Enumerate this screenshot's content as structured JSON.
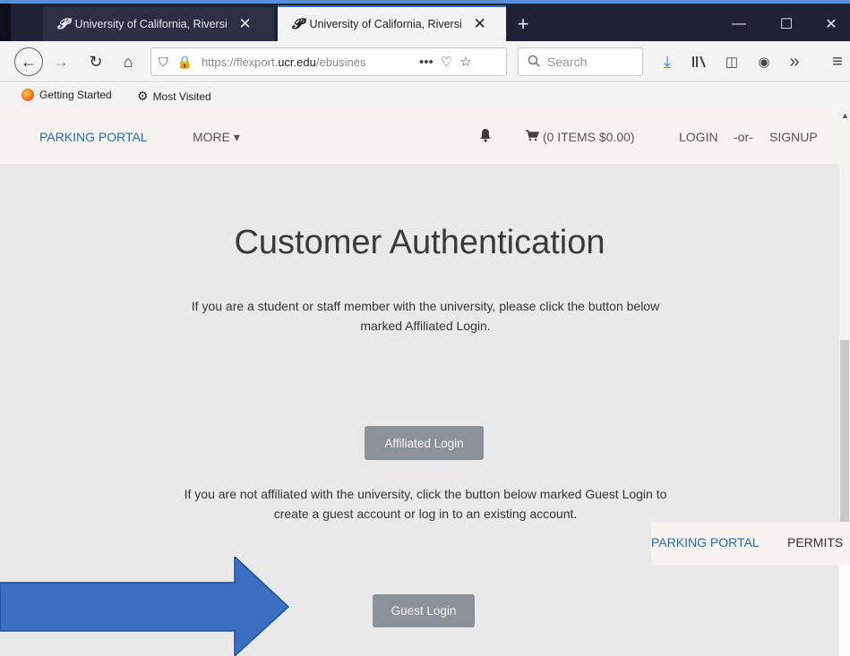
{
  "browser": {
    "tabs": [
      {
        "title": "University of California, Riversi",
        "icon": "p-favicon",
        "close": "✕"
      },
      {
        "title": "University of California, Riversi",
        "icon": "p-favicon",
        "close": "✕"
      }
    ],
    "tab_icon_glyph": "𝓟",
    "new_tab": "+",
    "window_controls": {
      "minimize": "—",
      "maximize": "☐",
      "close": "✕"
    },
    "nav": {
      "back": "←",
      "forward": "→",
      "reload": "↻",
      "home": "⌂"
    },
    "url": {
      "prefix": "https://flexport.",
      "domain": "ucr.edu",
      "suffix": "/ebusines",
      "shield": "⛉",
      "lock": "🔒",
      "more": "•••",
      "pocket": "♡",
      "star": "☆"
    },
    "search_placeholder": "Search",
    "toolbar": {
      "download": "⤓",
      "library": "ⅡＩ\\",
      "sidebar": "◫",
      "account": "◉",
      "overflow": "»",
      "menu": "≡"
    },
    "bookmarks": [
      {
        "label": "Getting Started",
        "icon": "firefox-icon"
      },
      {
        "label": "Most Visited",
        "icon": "gear-icon",
        "glyph": "⚙"
      }
    ]
  },
  "site_header": {
    "portal": "PARKING PORTAL",
    "more": "MORE",
    "more_chevron": "▾",
    "bell": "🔔",
    "cart_icon": "🛒",
    "cart": "(0 ITEMS $0.00)",
    "login": "LOGIN",
    "or": "-or-",
    "signup": "SIGNUP"
  },
  "main": {
    "title": "Customer Authentication",
    "affiliated_text": "If you are a student or staff member with the university, please click the button below marked Affiliated Login.",
    "affiliated_button": "Affiliated Login",
    "guest_text": "If you are not affiliated with the university, click the button below marked Guest Login to create a guest account or log in to an existing account.",
    "guest_button": "Guest Login"
  },
  "overlay_strip": {
    "portal": "PARKING PORTAL",
    "permits": "PERMITS"
  },
  "colors": {
    "accent_blue": "#2b6aa8",
    "arrow_blue": "#3a6ec0",
    "button_gray": "#8b9297",
    "tab_dark": "#1f2236"
  }
}
